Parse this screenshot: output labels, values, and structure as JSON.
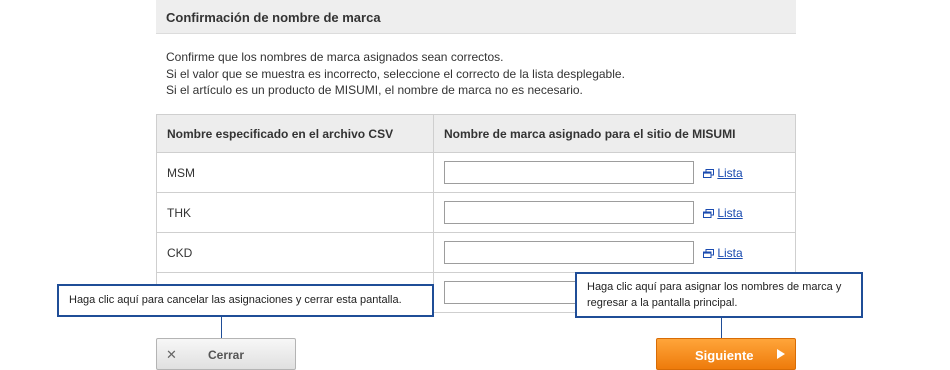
{
  "section": {
    "title": "Confirmación de nombre de marca"
  },
  "intro": {
    "line1": "Confirme que los nombres de marca asignados sean correctos.",
    "line2": "Si el valor que se muestra es incorrecto, seleccione el correcto de la lista desplegable.",
    "line3": "Si el artículo es un producto de MISUMI, el nombre de marca no es necesario."
  },
  "table": {
    "headers": [
      "Nombre especificado en el archivo CSV",
      "Nombre de marca asignado para el sitio de MISUMI"
    ],
    "rows": [
      {
        "name": "MSM",
        "value": "",
        "link": "Lista"
      },
      {
        "name": "THK",
        "value": "",
        "link": "Lista"
      },
      {
        "name": "CKD",
        "value": "",
        "link": "Lista"
      },
      {
        "name": "",
        "value": "",
        "link": ""
      }
    ]
  },
  "tips": {
    "cancel": "Haga clic aquí para cancelar las asignaciones y cerrar esta pantalla.",
    "assign_line1": "Haga clic aquí para asignar los nombres de marca y",
    "assign_line2": "regresar a la pantalla principal."
  },
  "buttons": {
    "close_label": "Cerrar",
    "next_label": "Siguiente"
  },
  "colors": {
    "accent_orange": "#f08a1e",
    "tip_border": "#1f4d97",
    "link": "#1a4bb0"
  }
}
